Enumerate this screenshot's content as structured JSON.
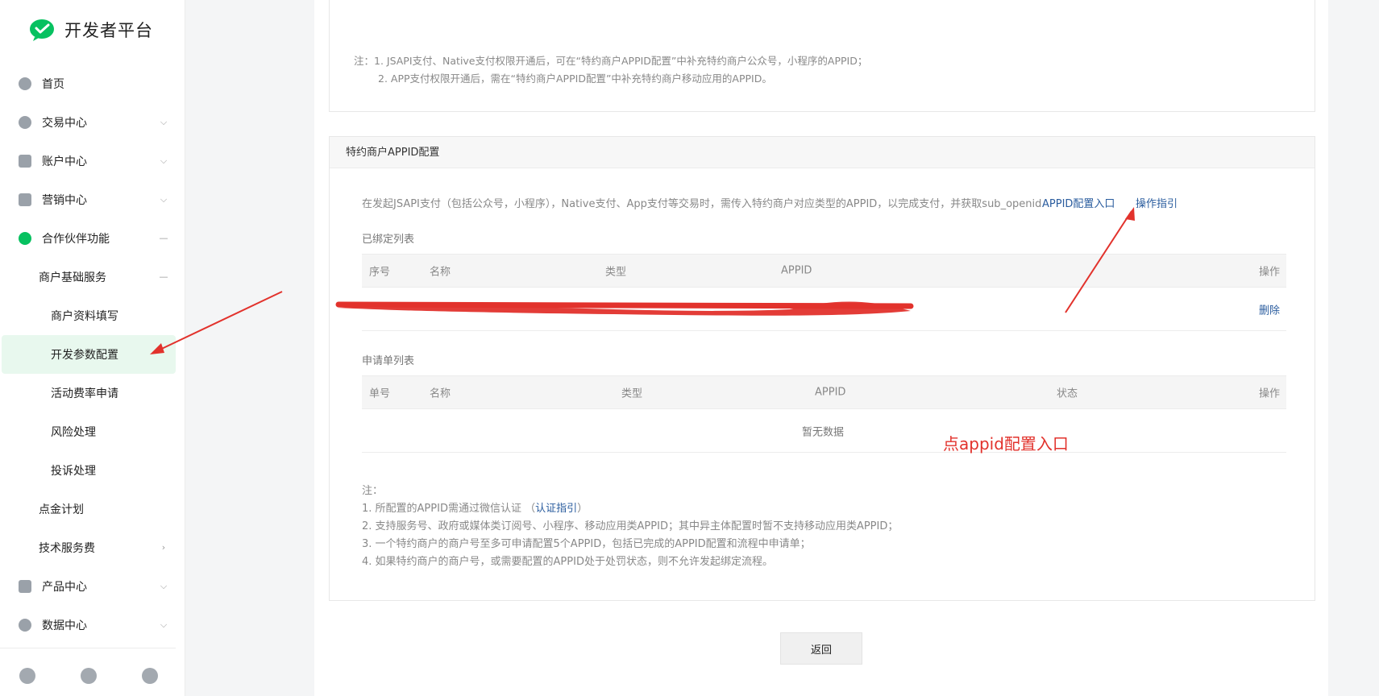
{
  "sidebar": {
    "logo_text": "开发者平台",
    "items": [
      {
        "label": "首页"
      },
      {
        "label": "交易中心"
      },
      {
        "label": "账户中心"
      },
      {
        "label": "营销中心"
      },
      {
        "label": "合作伙伴功能"
      },
      {
        "label": "商户基础服务"
      },
      {
        "label": "商户资料填写"
      },
      {
        "label": "开发参数配置"
      },
      {
        "label": "活动费率申请"
      },
      {
        "label": "风险处理"
      },
      {
        "label": "投诉处理"
      },
      {
        "label": "点金计划"
      },
      {
        "label": "技术服务费"
      },
      {
        "label": "产品中心"
      },
      {
        "label": "数据中心"
      }
    ],
    "bottom_icons": [
      "notification-icon",
      "bell-icon",
      "user-icon"
    ]
  },
  "top_card": {
    "note_line1": "注：1. JSAPI支付、Native支付权限开通后，可在“特约商户APPID配置”中补充特约商户公众号，小程序的APPID；",
    "note_line2": "2. APP支付权限开通后，需在“特约商户APPID配置”中补充特约商户移动应用的APPID。"
  },
  "appid_card": {
    "title": "特约商户APPID配置",
    "description": "在发起JSAPI支付（包括公众号，小程序），Native支付、App支付等交易时，需传入特约商户对应类型的APPID，以完成支付，并获取sub_openid",
    "config_link": "APPID配置入口",
    "guide_link": "操作指引",
    "bound_title": "已绑定列表",
    "bound_columns": [
      "序号",
      "名称",
      "类型",
      "APPID",
      "操作"
    ],
    "bound_row_action": "删除",
    "apply_title": "申请单列表",
    "apply_columns": [
      "单号",
      "名称",
      "类型",
      "APPID",
      "状态",
      "操作"
    ],
    "apply_empty": "暂无数据",
    "notes_title": "注：",
    "note1_prefix": "1. 所配置的APPID需通过微信认证 （",
    "note1_link": "认证指引",
    "note1_suffix": "）",
    "note2": "2. 支持服务号、政府或媒体类订阅号、小程序、移动应用类APPID；其中异主体配置时暂不支持移动应用类APPID；",
    "note3": "3. 一个特约商户的商户号至多可申请配置5个APPID，包括已完成的APPID配置和流程中申请单；",
    "note4": "4. 如果特约商户的商户号，或需要配置的APPID处于处罚状态，则不允许发起绑定流程。"
  },
  "back_button": "返回",
  "annotation": "点appid配置入口",
  "colors": {
    "brand_green": "#07c160",
    "link_blue": "#2a5c9e",
    "annotation_red": "#e2322c"
  }
}
